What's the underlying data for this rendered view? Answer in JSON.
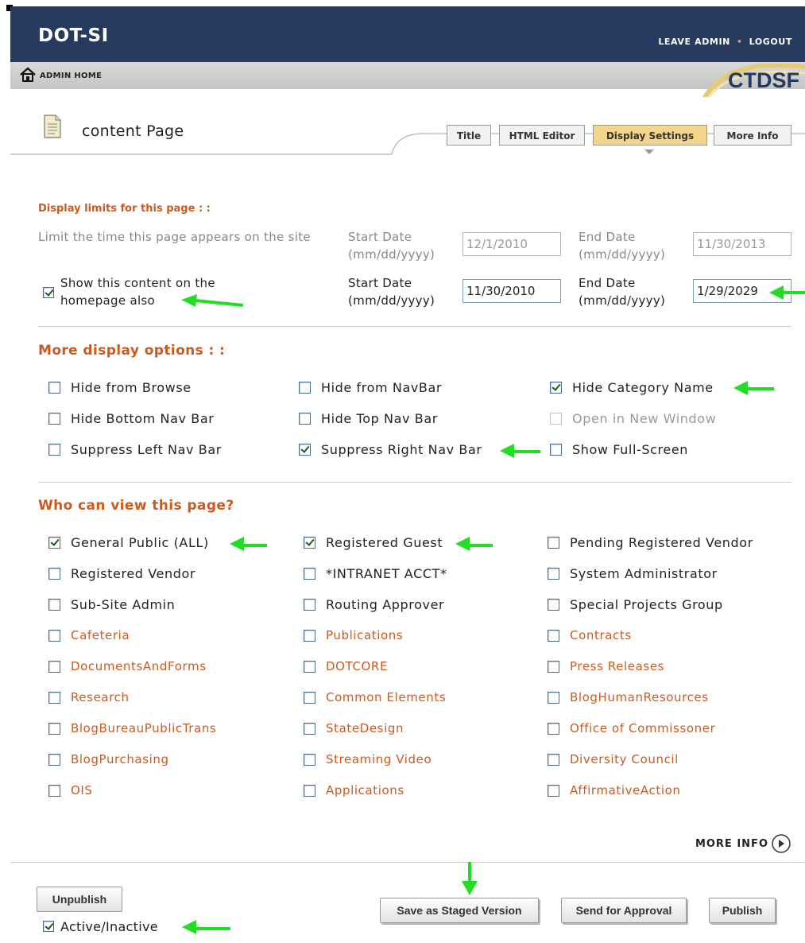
{
  "header": {
    "brand": "DOT-SI",
    "leave_admin": "LEAVE ADMIN",
    "logout": "LOGOUT",
    "admin_home": "ADMIN HOME",
    "logo_text": "CTDSF"
  },
  "page": {
    "title": "content Page"
  },
  "tabs": [
    {
      "label": "Title",
      "active": false
    },
    {
      "label": "HTML Editor",
      "active": false
    },
    {
      "label": "Display Settings",
      "active": true
    },
    {
      "label": "More Info",
      "active": false
    }
  ],
  "display_limits": {
    "heading": "Display limits for this page : :",
    "limit_time_label": "Limit the time this page appears on the site",
    "start_date_label": "Start Date (mm/dd/yyyy)",
    "end_date_label": "End Date (mm/dd/yyyy)",
    "start_date_1": "12/1/2010",
    "end_date_1": "11/30/2013",
    "homepage_label": "Show this content on the homepage also",
    "homepage_checked": true,
    "start_date_2": "11/30/2010",
    "end_date_2": "1/29/2029"
  },
  "more_options": {
    "heading": "More display options : :",
    "items": [
      {
        "label": "Hide from Browse",
        "checked": false
      },
      {
        "label": "Hide from NavBar",
        "checked": false
      },
      {
        "label": "Hide Category Name",
        "checked": true
      },
      {
        "label": "Hide Bottom Nav Bar",
        "checked": false
      },
      {
        "label": "Hide Top Nav Bar",
        "checked": false
      },
      {
        "label": "Open in New Window",
        "checked": false,
        "disabled": true
      },
      {
        "label": "Suppress Left Nav Bar",
        "checked": false
      },
      {
        "label": "Suppress Right Nav Bar",
        "checked": true
      },
      {
        "label": "Show Full-Screen",
        "checked": false
      }
    ]
  },
  "viewers": {
    "heading": "Who can view this page?",
    "items": [
      {
        "label": "General Public (ALL)",
        "checked": true
      },
      {
        "label": "Registered Guest",
        "checked": true
      },
      {
        "label": "Pending Registered Vendor",
        "checked": false
      },
      {
        "label": "Registered Vendor",
        "checked": false
      },
      {
        "label": "*INTRANET ACCT*",
        "checked": false
      },
      {
        "label": "System Administrator",
        "checked": false
      },
      {
        "label": "Sub-Site Admin",
        "checked": false
      },
      {
        "label": "Routing Approver",
        "checked": false
      },
      {
        "label": "Special Projects Group",
        "checked": false
      },
      {
        "label": "Cafeteria",
        "checked": false,
        "group": true
      },
      {
        "label": "Publications",
        "checked": false,
        "group": true
      },
      {
        "label": "Contracts",
        "checked": false,
        "group": true
      },
      {
        "label": "DocumentsAndForms",
        "checked": false,
        "group": true
      },
      {
        "label": "DOTCORE",
        "checked": false,
        "group": true
      },
      {
        "label": "Press Releases",
        "checked": false,
        "group": true
      },
      {
        "label": "Research",
        "checked": false,
        "group": true
      },
      {
        "label": "Common Elements",
        "checked": false,
        "group": true
      },
      {
        "label": "BlogHumanResources",
        "checked": false,
        "group": true
      },
      {
        "label": "BlogBureauPublicTrans",
        "checked": false,
        "group": true
      },
      {
        "label": "StateDesign",
        "checked": false,
        "group": true
      },
      {
        "label": "Office of Commissoner",
        "checked": false,
        "group": true
      },
      {
        "label": "BlogPurchasing",
        "checked": false,
        "group": true
      },
      {
        "label": "Streaming Video",
        "checked": false,
        "group": true
      },
      {
        "label": "Diversity Council",
        "checked": false,
        "group": true
      },
      {
        "label": "OIS",
        "checked": false,
        "group": true
      },
      {
        "label": "Applications",
        "checked": false,
        "group": true
      },
      {
        "label": "AffirmativeAction",
        "checked": false,
        "group": true
      }
    ]
  },
  "more_info_link": "MORE INFO",
  "footer": {
    "unpublish": "Unpublish",
    "active_label": "Active/Inactive",
    "active_checked": true,
    "save_staged": "Save as Staged Version",
    "send_approval": "Send for Approval",
    "publish": "Publish"
  },
  "colors": {
    "header_bg": "#263a5e",
    "accent_orange": "#cc5a1e",
    "tab_active": "#f5d58b",
    "annotation_arrow": "#22dd22"
  }
}
